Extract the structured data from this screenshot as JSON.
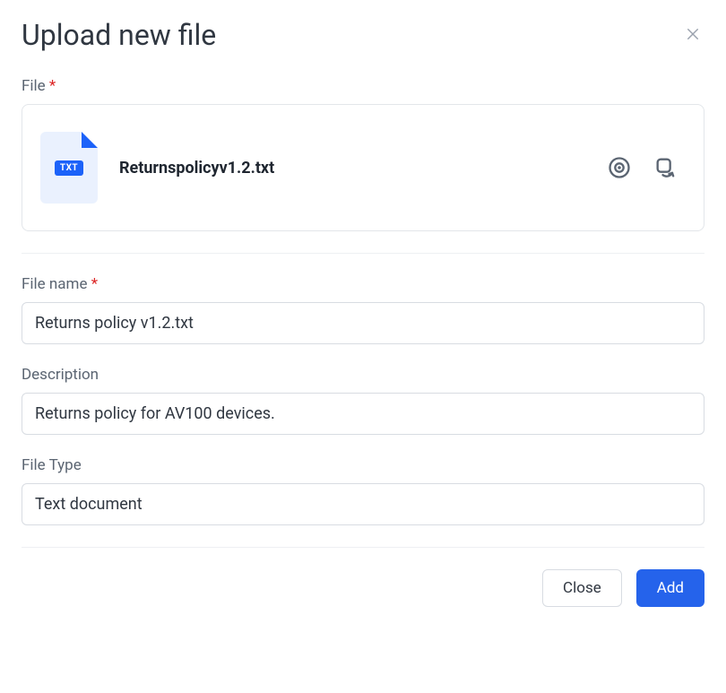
{
  "dialog": {
    "title": "Upload new file"
  },
  "labels": {
    "file": "File",
    "file_name": "File name",
    "description": "Description",
    "file_type": "File Type"
  },
  "file": {
    "ext_badge": "TXT",
    "display_name": "Returnspolicyv1.2.txt"
  },
  "fields": {
    "file_name": "Returns policy v1.2.txt",
    "description": "Returns policy for AV100 devices.",
    "file_type": "Text document"
  },
  "buttons": {
    "close": "Close",
    "add": "Add"
  }
}
